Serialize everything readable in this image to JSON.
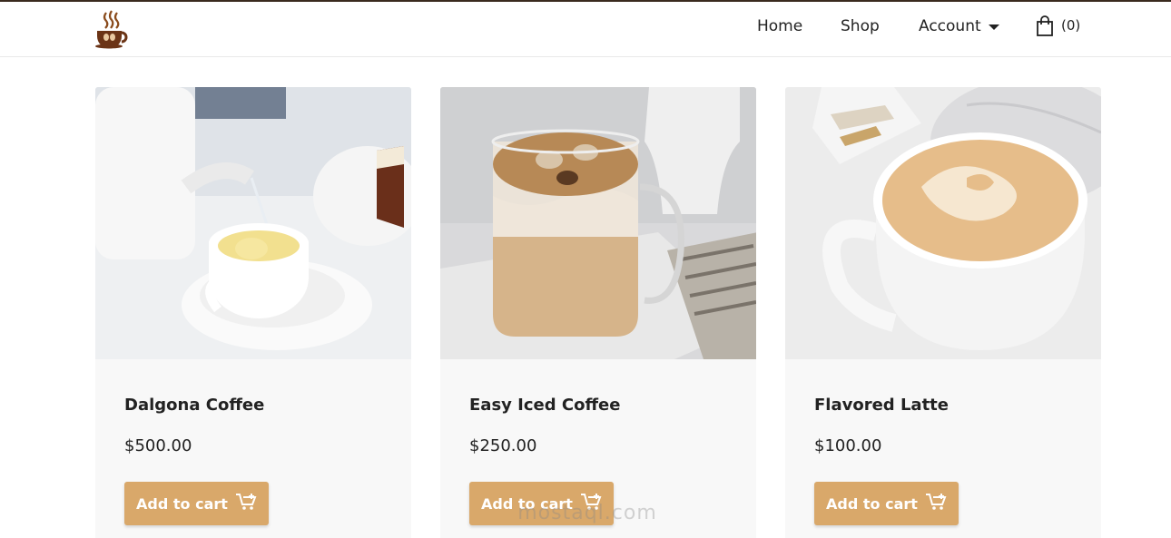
{
  "nav": {
    "home": "Home",
    "shop": "Shop",
    "account": "Account",
    "cart_count": "(0)"
  },
  "products": [
    {
      "title": "Dalgona Coffee",
      "price": "$500.00",
      "button": "Add to cart"
    },
    {
      "title": "Easy Iced Coffee",
      "price": "$250.00",
      "button": "Add to cart"
    },
    {
      "title": "Flavored Latte",
      "price": "$100.00",
      "button": "Add to cart"
    }
  ],
  "watermark": {
    "text": "mostaql.com"
  },
  "colors": {
    "accent": "#d9a86a",
    "top_border": "#3a2a1e",
    "card_bg": "#f8f8f8"
  },
  "icons": [
    "coffee-cup-logo-icon",
    "chevron-down-icon",
    "shopping-bag-icon",
    "add-to-cart-icon"
  ]
}
